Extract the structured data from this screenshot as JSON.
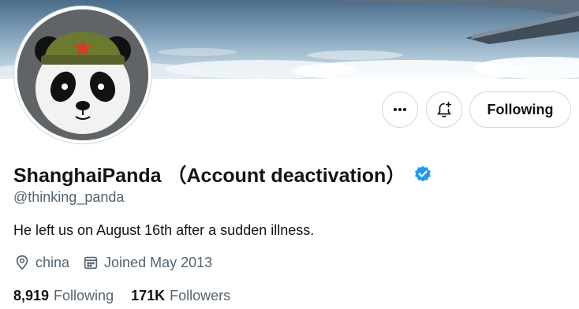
{
  "profile": {
    "display_name": "ShanghaiPanda （Account deactivation）",
    "handle": "@thinking_panda",
    "bio": "He left us on August 16th after a sudden illness.",
    "location": "china",
    "joined": "Joined May 2013",
    "following_count": "8,919",
    "following_label": "Following",
    "followers_count": "171K",
    "followers_label": "Followers"
  },
  "actions": {
    "more_icon": "more-icon",
    "notify_icon": "notification-bell-plus-icon",
    "follow_label": "Following"
  },
  "colors": {
    "verified": "#1d9bf0",
    "text_primary": "#0f1419",
    "text_secondary": "#536471",
    "border": "#cfd9de"
  }
}
